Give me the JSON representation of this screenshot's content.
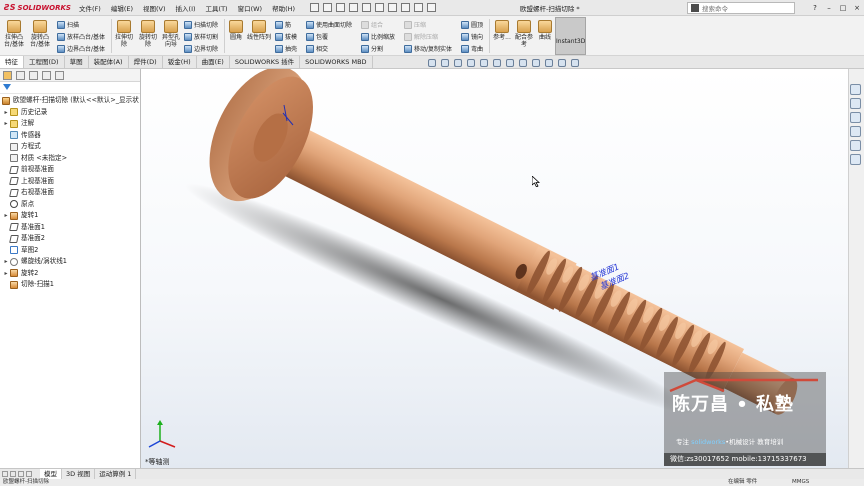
{
  "app": {
    "brand": "SOLIDWORKS",
    "brand_icon": "ds-logo-icon",
    "menu": [
      "文件(F)",
      "编辑(E)",
      "视图(V)",
      "插入(I)",
      "工具(T)",
      "窗口(W)",
      "帮助(H)"
    ],
    "document_title": "欧盟螺杆-扫描切除 *",
    "search_placeholder": "搜索命令",
    "window_controls": [
      "?",
      "–",
      "□",
      "×"
    ]
  },
  "ribbon": {
    "big_buttons": [
      {
        "label": "拉伸凸台/基体"
      },
      {
        "label": "旋转凸台/基体"
      },
      {
        "label": "拉伸切除"
      },
      {
        "label": "旋转切除"
      },
      {
        "label": "异型孔向导"
      },
      {
        "label": "圆角"
      },
      {
        "label": "线性阵列"
      },
      {
        "label": "参考..."
      },
      {
        "label": "配合参考"
      },
      {
        "label": "曲线"
      },
      {
        "label": "Instant3D"
      }
    ],
    "small_items": {
      "sweep": "扫描",
      "loft": "放样凸台/基体",
      "boundary_boss": "边界凸台/基体",
      "swept_cut": "扫描切除",
      "lofted_cut": "放样切割",
      "boundary_cut": "边界切除",
      "rib": "筋",
      "draft": "拔模",
      "shell": "抽壳",
      "wrap": "包覆",
      "intersect": "相交",
      "mirror": "镜向",
      "use_surface_cut": "使用曲面切除",
      "combine": "组合",
      "scale": "比例缩放",
      "split": "分割",
      "fold": "压缩",
      "unfold": "解除压缩",
      "move_copy_body": "移动/复制实体",
      "dome": "圆顶",
      "flex": "弯曲"
    }
  },
  "tabs": [
    "特征",
    "工程图(D)",
    "草图",
    "装配体(A)",
    "焊件(D)",
    "钣金(H)",
    "曲面(E)",
    "SOLIDWORKS 插件",
    "SOLIDWORKS MBD"
  ],
  "active_tab": "特征",
  "tree": {
    "root": "欧盟螺杆-扫描切除 (默认<<默认>_显示状",
    "nodes": [
      {
        "label": "历史记录",
        "icon": "history-icon",
        "toggle": "▸"
      },
      {
        "label": "注解",
        "icon": "annotations-icon",
        "toggle": "▸"
      },
      {
        "label": "传感器",
        "icon": "sensor-icon",
        "toggle": ""
      },
      {
        "label": "方程式",
        "icon": "equations-icon",
        "toggle": ""
      },
      {
        "label": "材质 <未指定>",
        "icon": "material-icon",
        "toggle": ""
      },
      {
        "label": "前视基准面",
        "icon": "plane-icon",
        "toggle": ""
      },
      {
        "label": "上视基准面",
        "icon": "plane-icon",
        "toggle": ""
      },
      {
        "label": "右视基准面",
        "icon": "plane-icon",
        "toggle": ""
      },
      {
        "label": "原点",
        "icon": "origin-icon",
        "toggle": ""
      },
      {
        "label": "旋转1",
        "icon": "revolve-icon",
        "toggle": "▸"
      },
      {
        "label": "基准面1",
        "icon": "plane-icon",
        "toggle": ""
      },
      {
        "label": "基准面2",
        "icon": "plane-icon",
        "toggle": ""
      },
      {
        "label": "草图2",
        "icon": "sketch-icon",
        "toggle": ""
      },
      {
        "label": "螺旋线/涡状线1",
        "icon": "helix-icon",
        "toggle": "▸"
      },
      {
        "label": "旋转2",
        "icon": "revolve-icon",
        "toggle": "▸"
      },
      {
        "label": "切除-扫描1",
        "icon": "swept-cut-icon",
        "toggle": ""
      }
    ]
  },
  "viewport": {
    "plane_labels": [
      "基准面1",
      "基准面2"
    ],
    "view_name": "*等轴测"
  },
  "bottom_tabs": [
    "模型",
    "3D 视图",
    "运动算例 1"
  ],
  "active_bottom_tab": "模型",
  "status": {
    "left": "欧盟螺杆-扫描切除",
    "mid": "在编辑 零件",
    "units": "MMGS"
  },
  "watermark": {
    "name": "陈万昌 • 私塾",
    "sub_prefix": "专注 ",
    "sub_highlight": "solidworks",
    "sub_suffix": "•机械设计 教育培训",
    "contact": "微信:zs30017652    mobile:13715337673"
  },
  "colors": {
    "part_copper": "#c9875a",
    "brand_red": "#c8102e",
    "plane_label_blue": "#2a3bd6"
  }
}
